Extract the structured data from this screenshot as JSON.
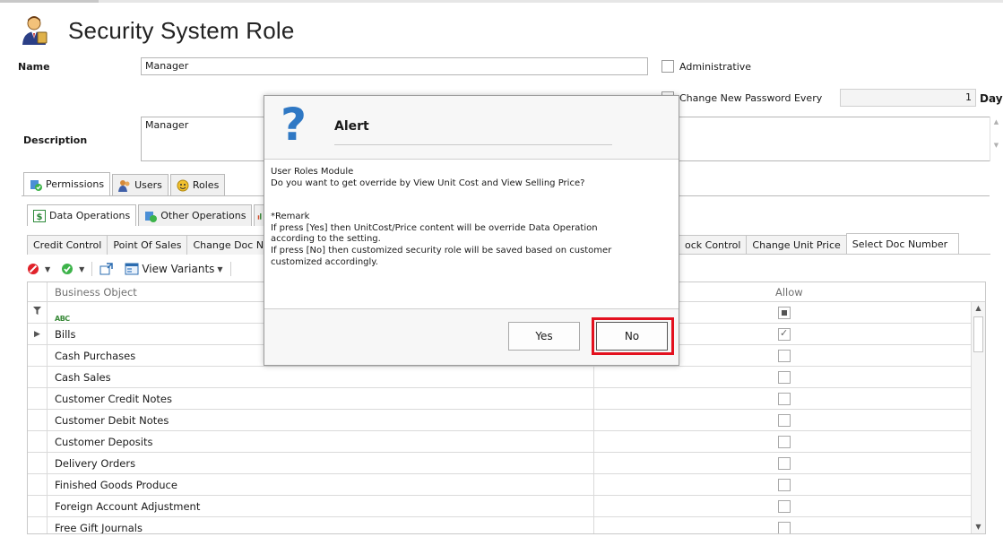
{
  "page": {
    "title": "Security System Role"
  },
  "form": {
    "name_label": "Name",
    "name_value": "Manager",
    "description_label": "Description",
    "description_value": "Manager",
    "administrative_label": "Administrative",
    "change_password_label": "Change New Password Every",
    "change_password_value": "1",
    "days_label": "Days"
  },
  "main_tabs": [
    {
      "label": "Permissions",
      "icon": "permissions-icon",
      "active": true
    },
    {
      "label": "Users",
      "icon": "users-icon",
      "active": false
    },
    {
      "label": "Roles",
      "icon": "roles-icon",
      "active": false
    }
  ],
  "operation_tabs": [
    {
      "label": "Data Operations",
      "icon": "dollar-icon",
      "active": true
    },
    {
      "label": "Other Operations",
      "icon": "operations-icon",
      "active": false
    }
  ],
  "sub_tabs": {
    "left": [
      "Credit Control",
      "Point Of Sales",
      "Change Doc Nu"
    ],
    "right": [
      {
        "label": "ock Control",
        "active": false
      },
      {
        "label": "Change Unit Price",
        "active": false
      },
      {
        "label": "Select Doc Number",
        "active": true
      }
    ]
  },
  "toolbar": {
    "view_variants_label": "View Variants"
  },
  "grid": {
    "col_business_object": "Business Object",
    "col_allow": "Allow",
    "filter_abc": "ABC",
    "rows": [
      {
        "name": "Bills",
        "allow": true
      },
      {
        "name": "Cash Purchases",
        "allow": false
      },
      {
        "name": "Cash Sales",
        "allow": false
      },
      {
        "name": "Customer Credit Notes",
        "allow": false
      },
      {
        "name": "Customer Debit Notes",
        "allow": false
      },
      {
        "name": "Customer Deposits",
        "allow": false
      },
      {
        "name": "Delivery Orders",
        "allow": false
      },
      {
        "name": "Finished Goods Produce",
        "allow": false
      },
      {
        "name": "Foreign Account Adjustment",
        "allow": false
      },
      {
        "name": "Free Gift Journals",
        "allow": false
      }
    ]
  },
  "dialog": {
    "title": "Alert",
    "icon": "question-icon",
    "line1": "User Roles Module",
    "line2": "Do you want to get override by View Unit Cost and View Selling Price?",
    "remark_title": "*Remark",
    "remark1": "If press [Yes] then UnitCost/Price content will be override Data Operation",
    "remark2": "according to the setting.",
    "remark3": "If press [No] then customized security role will be saved based on customer",
    "remark4": "customized accordingly.",
    "yes_label": "Yes",
    "no_label": "No"
  },
  "colors": {
    "highlight": "#e3101e",
    "question_icon": "#2f78c4"
  }
}
